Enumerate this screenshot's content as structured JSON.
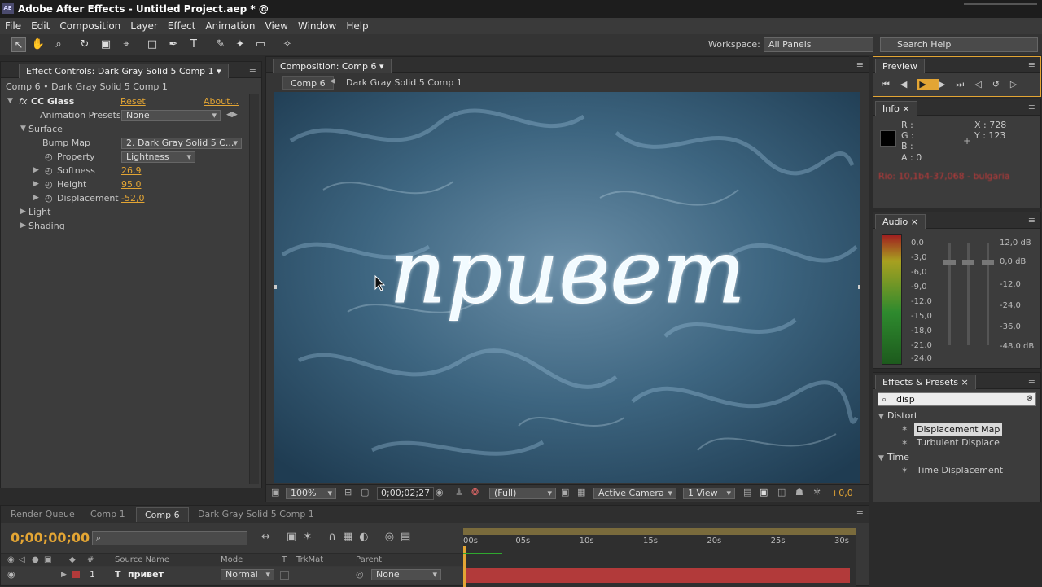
{
  "app": {
    "title": "Adobe After Effects - Untitled Project.aep * @",
    "logo": "AE"
  },
  "menu": [
    "File",
    "Edit",
    "Composition",
    "Layer",
    "Effect",
    "Animation",
    "View",
    "Window",
    "Help"
  ],
  "toolbar": {
    "workspace_label": "Workspace:",
    "workspace_value": "All Panels",
    "search_placeholder": "Search Help"
  },
  "effect_controls": {
    "tab_label": "Effect Controls: Dark Gray Solid 5 Comp 1",
    "breadcrumb": "Comp 6 • Dark Gray Solid 5 Comp 1",
    "effect_name": "CC Glass",
    "reset": "Reset",
    "about": "About...",
    "presets_label": "Animation Presets:",
    "presets_value": "None",
    "surface": "Surface",
    "bump_map_label": "Bump Map",
    "bump_map_value": "2. Dark Gray Solid 5 C...",
    "property_label": "Property",
    "property_value": "Lightness",
    "softness_label": "Softness",
    "softness_value": "26,9",
    "height_label": "Height",
    "height_value": "95,0",
    "displacement_label": "Displacement",
    "displacement_value": "-52,0",
    "light": "Light",
    "shading": "Shading"
  },
  "composition": {
    "tab_label": "Composition: Comp 6",
    "crumb_comp": "Comp 6",
    "crumb_layer": "Dark Gray Solid 5 Comp 1",
    "viewer_text": "привет",
    "zoom": "100%",
    "timecode": "0;00;02;27",
    "resolution": "(Full)",
    "camera": "Active Camera",
    "views": "1 View",
    "exposure": "+0,0"
  },
  "preview": {
    "tab": "Preview"
  },
  "info": {
    "tab": "Info",
    "r": "R :",
    "g": "G :",
    "b": "B :",
    "a": "A : 0",
    "x": "X : 728",
    "y": "Y : 123",
    "status": "Rio: 10,1b4-37,068 - bulgaria"
  },
  "audio": {
    "tab": "Audio",
    "left_scale": [
      "0,0",
      "-3,0",
      "-6,0",
      "-9,0",
      "-12,0",
      "-15,0",
      "-18,0",
      "-21,0",
      "-24,0"
    ],
    "right_scale": [
      "12,0 dB",
      "0,0 dB",
      "-12,0",
      "-24,0",
      "-36,0",
      "-48,0 dB"
    ]
  },
  "effects_presets": {
    "tab": "Effects & Presets",
    "search_value": "disp",
    "cat_distort": "Distort",
    "item1": "Displacement Map",
    "item2": "Turbulent Displace",
    "cat_time": "Time",
    "item3": "Time Displacement"
  },
  "timeline": {
    "tabs": [
      "Render Queue",
      "Comp 1",
      "Comp 6",
      "Dark Gray Solid 5 Comp 1"
    ],
    "timecode": "0;00;00;00",
    "ruler": [
      "00s",
      "05s",
      "10s",
      "15s",
      "20s",
      "25s",
      "30s"
    ],
    "col_source": "Source Name",
    "col_mode": "Mode",
    "col_t": "T",
    "col_trkmat": "TrkMat",
    "col_parent": "Parent",
    "layer_num": "1",
    "layer_name": "привет",
    "layer_mode": "Normal",
    "layer_parent": "None"
  },
  "colors": {
    "accent": "#e3a534",
    "viewer_bg": "#2a4d66",
    "layer_bar": "#b23a3a"
  }
}
